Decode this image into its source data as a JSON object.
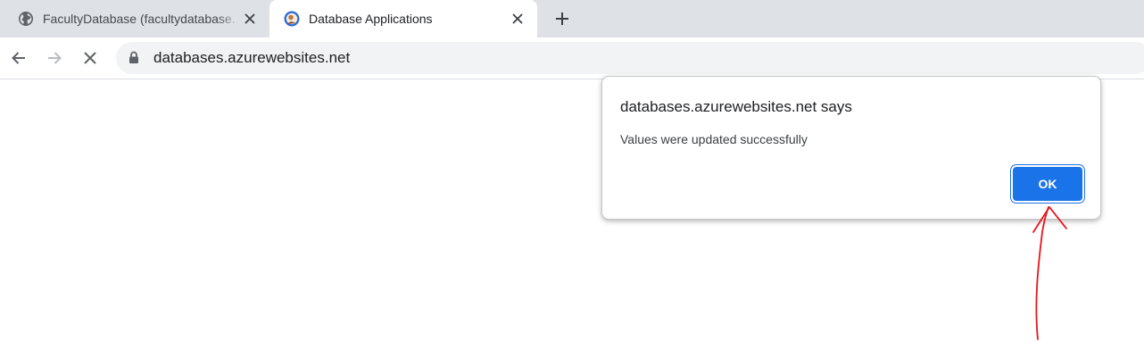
{
  "browser": {
    "tabs": [
      {
        "title": "FacultyDatabase (facultydatabase.",
        "favicon": "globe-icon",
        "active": false
      },
      {
        "title": "Database Applications",
        "favicon": "site-favicon",
        "active": true
      }
    ],
    "address": {
      "url": "databases.azurewebsites.net",
      "secure_icon": "lock-icon"
    },
    "nav_icons": [
      "back-arrow-icon",
      "forward-arrow-icon",
      "stop-loading-icon"
    ]
  },
  "dialog": {
    "title": "databases.azurewebsites.net says",
    "message": "Values were updated successfully",
    "ok_label": "OK"
  },
  "colors": {
    "tabstrip_bg": "#dee1e6",
    "omnibox_bg": "#f1f3f4",
    "primary_button": "#1a73e8",
    "annotation": "#e8141c"
  },
  "annotation": {
    "type": "hand-drawn arrow pointing to OK button"
  }
}
